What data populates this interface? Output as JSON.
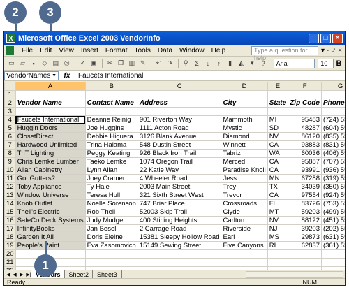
{
  "callouts": [
    "2",
    "3",
    "1"
  ],
  "window": {
    "app_title": "Microsoft Office Excel 2003 VendorInfo",
    "min": "_",
    "max": "□",
    "close": "×"
  },
  "menu": {
    "items": [
      "File",
      "Edit",
      "View",
      "Insert",
      "Format",
      "Tools",
      "Data",
      "Window",
      "Help"
    ],
    "ask_placeholder": "Type a question for help",
    "ctrl": "▾ - ♂ ×"
  },
  "toolbar": {
    "font": "Arial",
    "size": "10",
    "bold": "B"
  },
  "formula_bar": {
    "name_box": "VendorNames",
    "fx": "fx",
    "content": "Faucets International"
  },
  "grid": {
    "columns": [
      "A",
      "B",
      "C",
      "D",
      "E",
      "F",
      "G"
    ],
    "rows": [
      {
        "n": "1",
        "cells": [
          "",
          "",
          "",
          "",
          "",
          "",
          ""
        ]
      },
      {
        "n": "2",
        "cells": [
          "Vendor Name",
          "Contact Name",
          "Address",
          "City",
          "State",
          "Zip Code",
          "Phone Nu"
        ],
        "header": true
      },
      {
        "n": "3",
        "cells": [
          "",
          "",
          "",
          "",
          "",
          "",
          ""
        ]
      },
      {
        "n": "4",
        "cells": [
          "Faucets International",
          "Deanne Reinig",
          "901 Riverton Way",
          "Mammoth",
          "MI",
          "95483",
          "(724) 555-8"
        ]
      },
      {
        "n": "5",
        "cells": [
          "Huggin Doors",
          "Joe Huggins",
          "1111 Acton Road",
          "Mystic",
          "SD",
          "48287",
          "(604) 555-1"
        ]
      },
      {
        "n": "6",
        "cells": [
          "ClosetDirect",
          "Debbie Higuera",
          "3126 Blank Avenue",
          "Diamond",
          "NV",
          "86120",
          "(835) 555-4"
        ]
      },
      {
        "n": "7",
        "cells": [
          "Hardwood Unlimited",
          "Trina Halama",
          "548 Dustin Street",
          "Winnett",
          "CA",
          "93883",
          "(831) 555-2"
        ]
      },
      {
        "n": "8",
        "cells": [
          "TnT Lighting",
          "Peggy Keating",
          "926 Black Iron Trail",
          "Tabriz",
          "WA",
          "60036",
          "(406) 555-1"
        ]
      },
      {
        "n": "9",
        "cells": [
          "Chris Lemke Lumber",
          "Taeko Lemke",
          "1074 Oregon Trail",
          "Merced",
          "CA",
          "95887",
          "(707) 555-2"
        ]
      },
      {
        "n": "10",
        "cells": [
          "Allan Cabinetry",
          "Lynn Allan",
          "22 Katie Way",
          "Paradise Knoll",
          "CA",
          "93991",
          "(936) 555-0"
        ]
      },
      {
        "n": "11",
        "cells": [
          "Got Gutters?",
          "Joey Cramer",
          "4 Wheeler Road",
          "Jess",
          "MN",
          "67288",
          "(319) 555-0"
        ]
      },
      {
        "n": "12",
        "cells": [
          "Toby Appliance",
          "Ty Hale",
          "2003 Main Street",
          "Trey",
          "TX",
          "34039",
          "(350) 555-9"
        ]
      },
      {
        "n": "13",
        "cells": [
          "Window Universe",
          "Teresa Hull",
          "321 Sixth Street West",
          "Trevor",
          "CA",
          "97554",
          "(924) 555-7"
        ]
      },
      {
        "n": "14",
        "cells": [
          "Knob Outlet",
          "Noelle Sorenson",
          "747 Briar Place",
          "Crossroads",
          "FL",
          "83726",
          "(753) 555-1"
        ]
      },
      {
        "n": "15",
        "cells": [
          "Theil's Electric",
          "Rob Theil",
          "52003 Skip Trail",
          "Clyde",
          "MT",
          "59203",
          "(499) 555-2"
        ]
      },
      {
        "n": "16",
        "cells": [
          "SafeCo Deck Systems",
          "Judy Mudge",
          "400 Stirling Heights",
          "Carlton",
          "NV",
          "88122",
          "(451) 555-0"
        ]
      },
      {
        "n": "17",
        "cells": [
          "InfinityBooks",
          "Jan Besel",
          "2 Carrage Road",
          "Riverside",
          "NJ",
          "39203",
          "(202) 555-9"
        ]
      },
      {
        "n": "18",
        "cells": [
          "Garden It All",
          "Doris Eleine",
          "15381 Sleepy Hollow Road",
          "Earl",
          "MS",
          "29873",
          "(631) 555-2"
        ]
      },
      {
        "n": "19",
        "cells": [
          "People's Paint",
          "Eva Zasomovich",
          "15149 Sewing Street",
          "Five Canyons",
          "RI",
          "62837",
          "(361) 555-9"
        ]
      },
      {
        "n": "20",
        "cells": [
          "",
          "",
          "",
          "",
          "",
          "",
          ""
        ]
      },
      {
        "n": "21",
        "cells": [
          "",
          "",
          "",
          "",
          "",
          "",
          ""
        ]
      },
      {
        "n": "22",
        "cells": [
          "",
          "",
          "",
          "",
          "",
          "",
          ""
        ]
      }
    ]
  },
  "sheets": [
    "Vendors",
    "Sheet2",
    "Sheet3"
  ],
  "status": {
    "left": "Ready",
    "num": "NUM"
  }
}
